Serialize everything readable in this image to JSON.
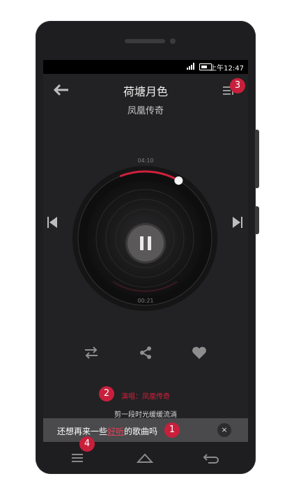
{
  "status_bar": {
    "time": "上午12:47"
  },
  "header": {
    "title": "荷塘月色",
    "artist": "凤凰传奇"
  },
  "player": {
    "total_time": "04:10",
    "current_time": "00:21",
    "progress": 0.084
  },
  "info": {
    "singer": "演唱：凤凰传奇",
    "lyric": "剪一段时光缓缓流淌"
  },
  "toast": {
    "text_before": "还想再来一些",
    "text_highlight": "好听",
    "text_after": "的歌曲吗",
    "close_label": "×"
  },
  "badges": {
    "b1": "1",
    "b2": "2",
    "b3": "3",
    "b4": "4"
  },
  "icons": {
    "back": "arrow-left-icon",
    "playlist": "playlist-icon",
    "prev": "skip-prev-icon",
    "next": "skip-next-icon",
    "pause": "pause-icon",
    "shuffle": "shuffle-icon",
    "share": "share-icon",
    "like": "heart-icon",
    "menu": "menu-icon",
    "home": "home-icon",
    "return": "return-icon"
  },
  "colors": {
    "accent": "#c8203c",
    "background": "#222224",
    "phone_body": "#1e1e20"
  }
}
